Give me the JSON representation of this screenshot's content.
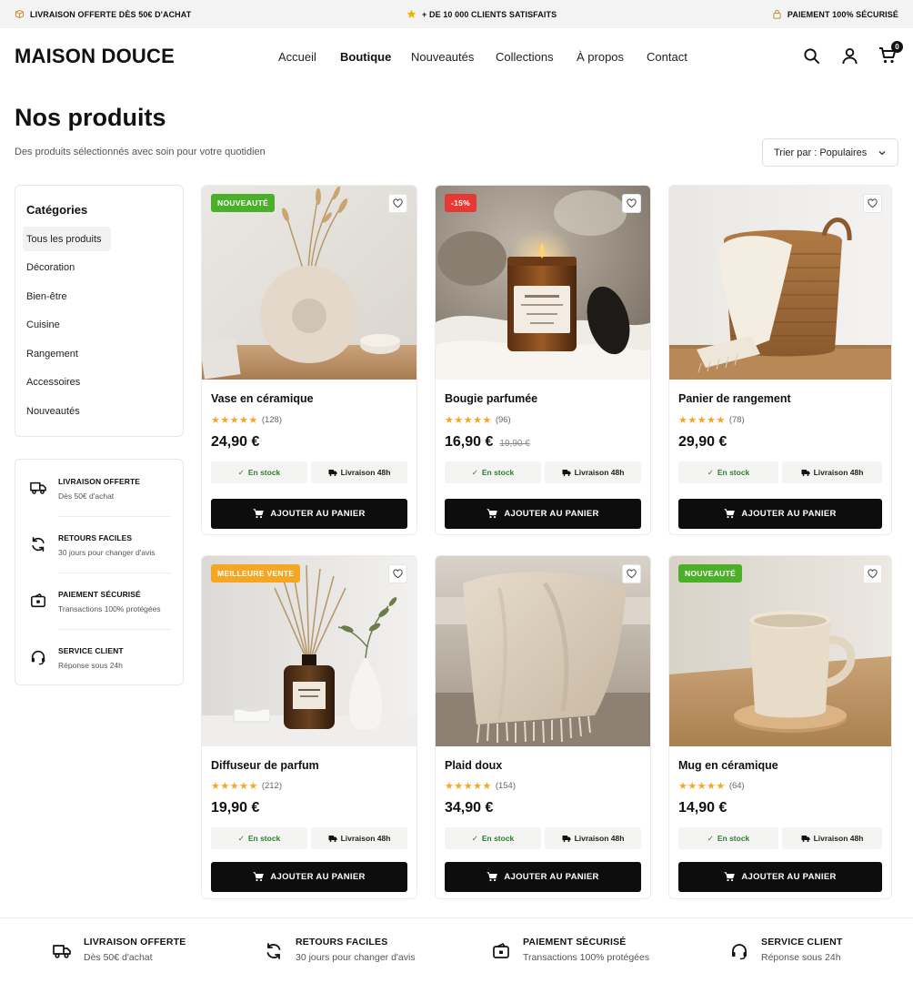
{
  "topbar": {
    "left": "LIVRAISON OFFERTE DÈS 50€ D'ACHAT",
    "center": "+ DE 10 000 CLIENTS SATISFAITS",
    "right": "PAIEMENT 100% SÉCURISÉ"
  },
  "header": {
    "logo": "MAISON DOUCE",
    "nav": [
      "Accueil",
      "Boutique",
      "Nouveautés",
      "Collections",
      "À propos",
      "Contact"
    ],
    "active_nav": "Boutique",
    "cart_count": "0"
  },
  "page": {
    "title": "Nos produits",
    "subtitle": "Des produits sélectionnés avec soin pour votre quotidien",
    "sort_label": "Trier par : Populaires"
  },
  "categories": {
    "title": "Catégories",
    "items": [
      "Tous les produits",
      "Décoration",
      "Bien-être",
      "Cuisine",
      "Rangement",
      "Accessoires",
      "Nouveautés"
    ],
    "active": "Tous les produits"
  },
  "services": [
    {
      "title": "LIVRAISON OFFERTE",
      "subtitle": "Dès 50€ d'achat",
      "icon": "truck-icon"
    },
    {
      "title": "RETOURS FACILES",
      "subtitle": "30 jours pour changer d'avis",
      "icon": "refresh-icon"
    },
    {
      "title": "PAIEMENT SÉCURISÉ",
      "subtitle": "Transactions 100% protégées",
      "icon": "secure-wallet-icon"
    },
    {
      "title": "SERVICE CLIENT",
      "subtitle": "Réponse sous 24h",
      "icon": "headset-icon"
    }
  ],
  "products": [
    {
      "name": "Vase en céramique",
      "rating_stars": "★★★★★",
      "reviews": "(128)",
      "price": "24,90 €",
      "old_price": "",
      "badge": "NOUVEAUTÉ",
      "badge_color": "#4caf2a",
      "stock": "En stock",
      "delivery": "Livraison 48h",
      "button": "AJOUTER AU PANIER",
      "image": "vase-image"
    },
    {
      "name": "Bougie parfumée",
      "rating_stars": "★★★★★",
      "reviews": "(96)",
      "price": "16,90 €",
      "old_price": "19,90 €",
      "badge": "-15%",
      "badge_color": "#e53935",
      "stock": "En stock",
      "delivery": "Livraison 48h",
      "button": "AJOUTER AU PANIER",
      "image": "candle-image"
    },
    {
      "name": "Panier de rangement",
      "rating_stars": "★★★★★",
      "reviews": "(78)",
      "price": "29,90 €",
      "old_price": "",
      "badge": "",
      "badge_color": "",
      "stock": "En stock",
      "delivery": "Livraison 48h",
      "button": "AJOUTER AU PANIER",
      "image": "basket-image"
    },
    {
      "name": "Diffuseur de parfum",
      "rating_stars": "★★★★★",
      "reviews": "(212)",
      "price": "19,90 €",
      "old_price": "",
      "badge": "MEILLEURE VENTE",
      "badge_color": "#f5a623",
      "stock": "En stock",
      "delivery": "Livraison 48h",
      "button": "AJOUTER AU PANIER",
      "image": "diffuser-image"
    },
    {
      "name": "Plaid doux",
      "rating_stars": "★★★★★",
      "reviews": "(154)",
      "price": "34,90 €",
      "old_price": "",
      "badge": "",
      "badge_color": "",
      "stock": "En stock",
      "delivery": "Livraison 48h",
      "button": "AJOUTER AU PANIER",
      "image": "blanket-image"
    },
    {
      "name": "Mug en céramique",
      "rating_stars": "★★★★★",
      "reviews": "(64)",
      "price": "14,90 €",
      "old_price": "",
      "badge": "NOUVEAUTÉ",
      "badge_color": "#4caf2a",
      "stock": "En stock",
      "delivery": "Livraison 48h",
      "button": "AJOUTER AU PANIER",
      "image": "mug-image"
    }
  ],
  "colors": {
    "accent": "#0d0d0d",
    "stock_green": "#2f7d32",
    "star": "#f5a623"
  }
}
